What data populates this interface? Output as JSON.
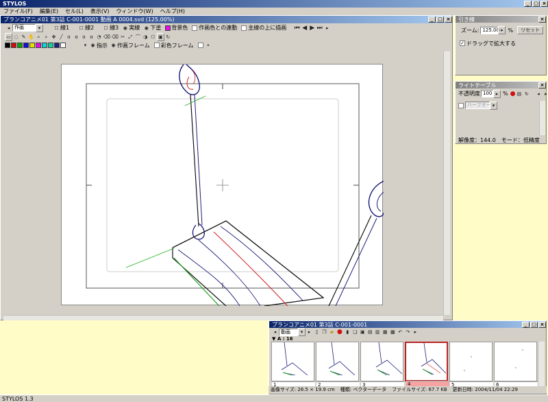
{
  "app": {
    "title": "STYLOS",
    "status": "STYLOS 1.3"
  },
  "menu": [
    "ファイル(F)",
    "編集(E)",
    "セル(L)",
    "表示(V)",
    "ウィンドウ(W)",
    "ヘルプ(H)"
  ],
  "doc_window": {
    "title": "プランコアニメ01 第3話 C-001-0001 動画 A 0004.svd (125.00%)",
    "layer_select": "作画",
    "layer_tabs": [
      "線1",
      "線2",
      "線3"
    ],
    "toggles": {
      "solid_line": "実線",
      "under": "下塗",
      "background_color": "背景色",
      "link_to_art_color": "作画色との連動",
      "draw_on_main_line": "主線の上に描画"
    },
    "row3": {
      "instruction": "指示",
      "art_frame": "作画フレーム",
      "color_frame": "彩色フレーム"
    },
    "palette": [
      "#000000",
      "#d01010",
      "#10a010",
      "#1010d0",
      "#e0e000",
      "#e010e0",
      "#10d0d0",
      "#10d0a0",
      "#202080",
      "#ffffff"
    ]
  },
  "guide_panel": {
    "title": "引き線",
    "zoom_label": "ズーム:",
    "zoom_value": "125.00",
    "zoom_unit": "%",
    "reset_label": "リセット",
    "drag_zoom_label": "ドラッグで拡大する"
  },
  "light_table": {
    "title": "ライトテーブル",
    "opacity_label": "不透明度",
    "opacity_value": "100",
    "opacity_unit": "%",
    "layer_select": "ハーフオーン",
    "resolution_text": "解像度：144.0",
    "mode_text": "モード：低精度"
  },
  "sheet_window": {
    "title": "プランコアニメ01 第3話 C-001-0001",
    "sheet_select": "動画",
    "column_label": "▼ A : 16",
    "frames": [
      "1",
      "2",
      "3",
      "4",
      "5",
      "6"
    ],
    "selected_index": 3,
    "status": {
      "image_size": "画像サイズ: 26.5 × 19.9 cm",
      "kind": "種類: ベクターデータ",
      "file_size": "ファイルサイズ: 67.7 KB",
      "updated": "更新日時: 2004/11/04 22:29"
    }
  }
}
